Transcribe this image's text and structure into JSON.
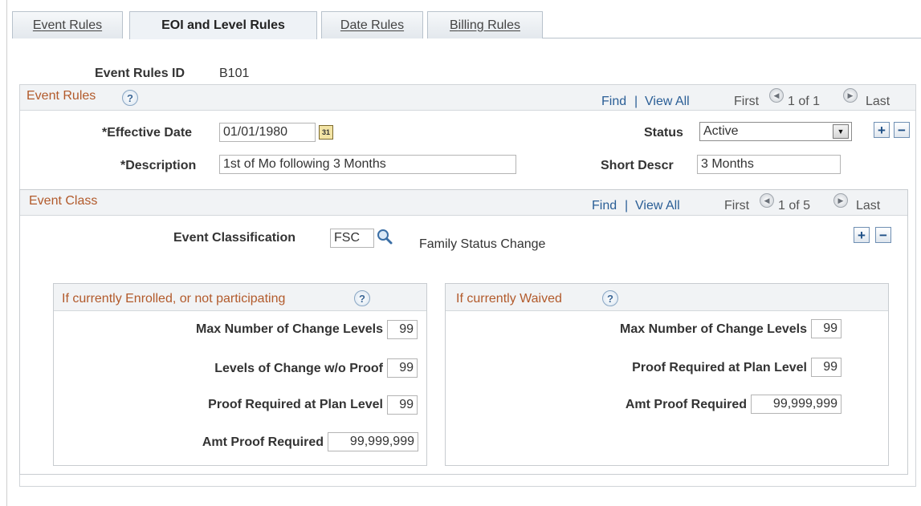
{
  "tabs": [
    {
      "hotkey": "E",
      "rest": "vent Rules"
    },
    {
      "label": "EOI and Level Rules"
    },
    {
      "hotkey": "D",
      "rest": "ate Rules"
    },
    {
      "hotkey": "B",
      "rest": "illing Rules"
    }
  ],
  "header": {
    "id_label": "Event Rules ID",
    "id_value": "B101"
  },
  "event_rules": {
    "title": "Event Rules",
    "find": "Find",
    "view_all": "View All",
    "sep": "|",
    "first": "First",
    "count": "1 of 1",
    "last": "Last",
    "effective_date_label": "*Effective Date",
    "effective_date": "01/01/1980",
    "status_label": "Status",
    "status_value": "Active",
    "description_label": "*Description",
    "description": "1st of Mo following 3 Months",
    "short_descr_label": "Short Descr",
    "short_descr": "3 Months",
    "add": "+",
    "remove": "−"
  },
  "event_class": {
    "title": "Event Class",
    "find": "Find",
    "view_all": "View All",
    "sep": "|",
    "first": "First",
    "count": "1 of 5",
    "last": "Last",
    "classification_label": "Event Classification",
    "classification_value": "FSC",
    "classification_desc": "Family Status Change",
    "add": "+",
    "remove": "−"
  },
  "enrolled": {
    "title": "If currently Enrolled, or not participating",
    "fields": [
      {
        "label": "Max Number of Change Levels",
        "value": "99"
      },
      {
        "label": "Levels of Change w/o Proof",
        "value": "99"
      },
      {
        "label": "Proof Required at Plan Level",
        "value": "99"
      },
      {
        "label": "Amt Proof Required",
        "value": "99,999,999"
      }
    ]
  },
  "waived": {
    "title": "If currently Waived",
    "fields": [
      {
        "label": "Max Number of Change Levels",
        "value": "99"
      },
      {
        "label": "Proof Required at Plan Level",
        "value": "99"
      },
      {
        "label": "Amt Proof Required",
        "value": "99,999,999"
      }
    ]
  },
  "icons": {
    "help": "?",
    "prev": "◀",
    "next": "▶",
    "dropdown": "▼",
    "calendar": "31"
  },
  "colors": {
    "section_title": "#b25a2b",
    "link": "#2a5e96"
  }
}
